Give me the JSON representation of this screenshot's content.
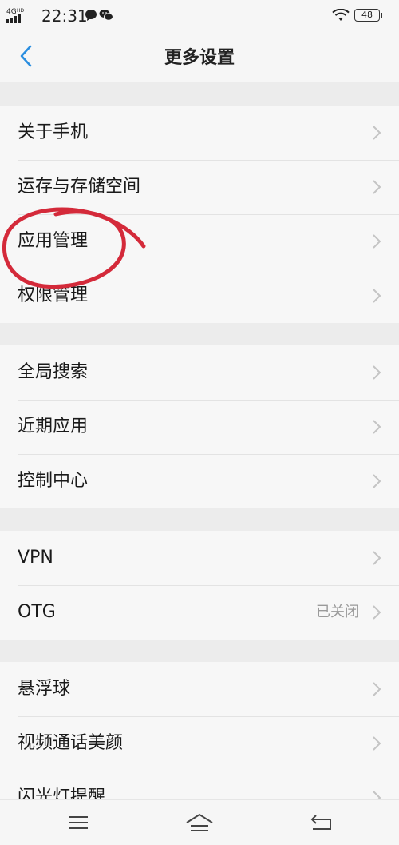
{
  "status_bar": {
    "network": "4G",
    "network_hd": "HD",
    "time": "22:31",
    "battery": "48",
    "icons": [
      "signal-icon",
      "message-icon",
      "wechat-icon",
      "wifi-icon",
      "battery-icon"
    ]
  },
  "header": {
    "title": "更多设置",
    "back_icon": "chevron-left-icon",
    "accent": "#2a8ee0"
  },
  "groups": [
    {
      "items": [
        {
          "label": "关于手机"
        },
        {
          "label": "运存与存储空间"
        },
        {
          "label": "应用管理"
        },
        {
          "label": "权限管理"
        }
      ]
    },
    {
      "items": [
        {
          "label": "全局搜索"
        },
        {
          "label": "近期应用"
        },
        {
          "label": "控制中心"
        }
      ]
    },
    {
      "items": [
        {
          "label": "VPN"
        },
        {
          "label": "OTG",
          "value": "已关闭"
        }
      ]
    },
    {
      "items": [
        {
          "label": "悬浮球"
        },
        {
          "label": "视频通话美颜"
        },
        {
          "label": "闪光灯提醒"
        }
      ]
    }
  ],
  "annotation": {
    "color": "#d42a3a"
  },
  "bottom_nav": {
    "icons": [
      "menu-icon",
      "home-icon",
      "back-icon"
    ]
  }
}
